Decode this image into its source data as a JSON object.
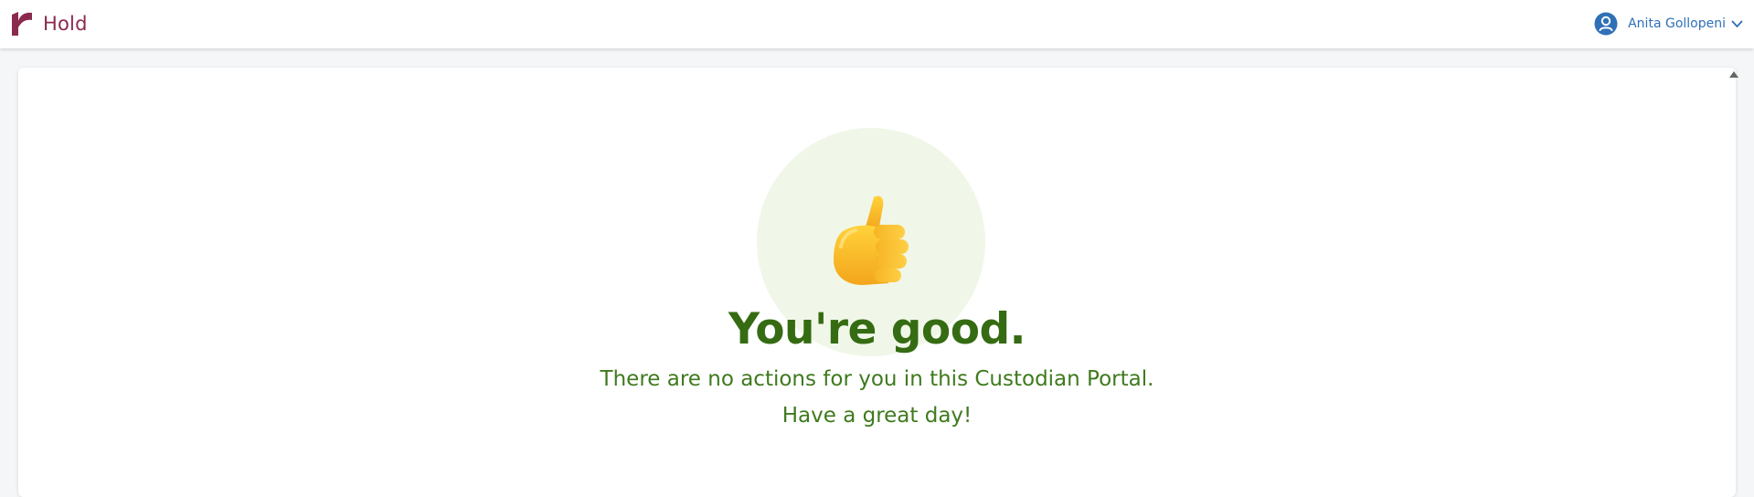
{
  "header": {
    "app_name": "Hold",
    "logo_icon": "r-logo-icon",
    "brand_color": "#8a2a4e",
    "user": {
      "name": "Anita Gollopeni",
      "avatar_icon": "user-circle-icon",
      "menu_icon": "chevron-down-icon",
      "accent_color": "#2f70b7"
    }
  },
  "main": {
    "illustration_icon": "thumbs-up-icon",
    "headline": "You're good.",
    "message": "There are no actions for you in this Custodian Portal.",
    "farewell": "Have a great day!",
    "text_color": "#356b12",
    "circle_color": "#f0f7e8"
  }
}
